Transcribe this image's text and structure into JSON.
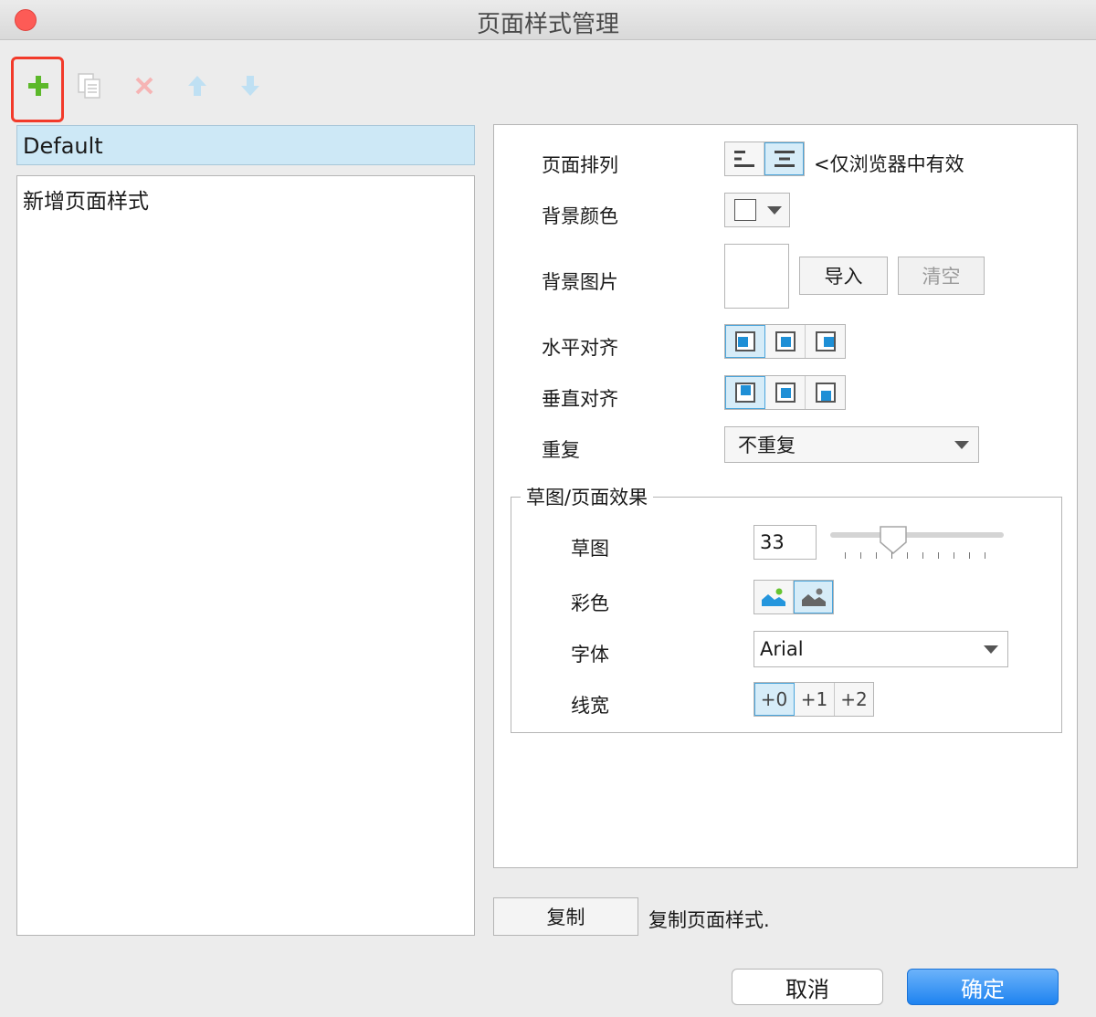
{
  "window": {
    "title": "页面样式管理"
  },
  "toolbar": {
    "add_icon": "plus-icon",
    "duplicate_icon": "copy-icon",
    "delete_icon": "delete-icon",
    "move_up_icon": "arrow-up-icon",
    "move_down_icon": "arrow-down-icon",
    "add_color": "#5cb82a"
  },
  "styles_list": {
    "selected": "Default",
    "items": [
      "新增页面样式"
    ]
  },
  "properties": {
    "page_align_label": "页面排列",
    "page_align_note": "<仅浏览器中有效",
    "bg_color_label": "背景颜色",
    "bg_image_label": "背景图片",
    "import_label": "导入",
    "clear_label": "清空",
    "h_align_label": "水平对齐",
    "v_align_label": "垂直对齐",
    "repeat_label": "重复",
    "repeat_value": "不重复",
    "sketch_group": {
      "legend": "草图/页面效果",
      "sketch_label": "草图",
      "sketch_value": "33",
      "color_label": "彩色",
      "font_label": "字体",
      "font_value": "Arial",
      "line_width_label": "线宽",
      "line_width_options": [
        "+0",
        "+1",
        "+2"
      ]
    }
  },
  "copy": {
    "button_label": "复制",
    "description": "复制页面样式."
  },
  "footer": {
    "cancel_label": "取消",
    "ok_label": "确定"
  },
  "accent_color": "#1e8fd6"
}
